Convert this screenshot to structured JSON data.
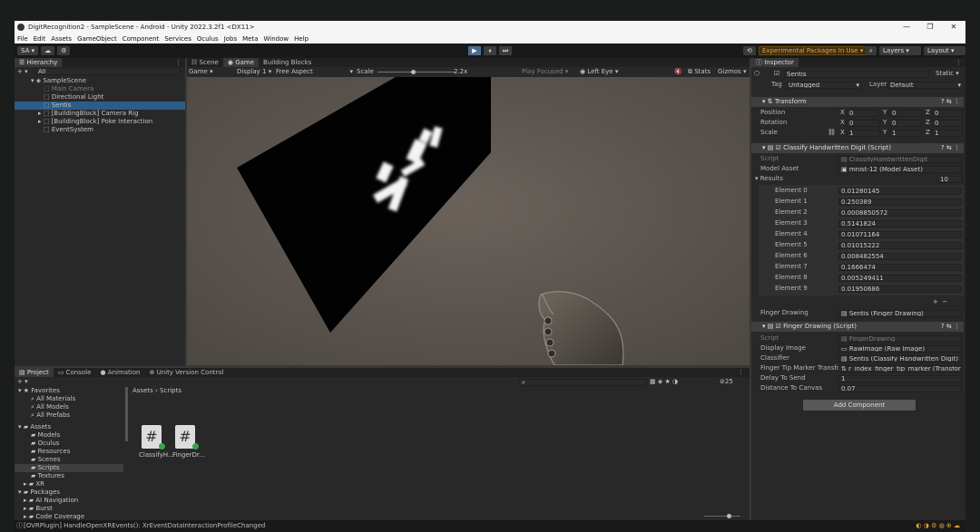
{
  "window": {
    "title": "DigitRecognition2 - SampleScene - Android - Unity 2022.3.2f1 <DX11>",
    "min": "—",
    "max": "❐",
    "close": "✕"
  },
  "menu": [
    "File",
    "Edit",
    "Assets",
    "GameObject",
    "Component",
    "Services",
    "Oculus",
    "Jobs",
    "Meta",
    "Window",
    "Help"
  ],
  "toolbar": {
    "account": "SA ▾",
    "play": "▶",
    "pause": "⏸",
    "step": "⏭",
    "experimental": "Experimental Packages In Use ▾",
    "layers": "Layers",
    "layout": "Layout"
  },
  "hierarchy": {
    "tab": "Hierarchy",
    "search": "All",
    "scene": "SampleScene",
    "items": [
      "Main Camera",
      "Directional Light",
      "Sentis",
      "[BuildingBlock] Camera Rig",
      "[BuildingBlock] Poke Interaction",
      "EventSystem"
    ]
  },
  "sceneTabs": [
    "Scene",
    "Game",
    "Building Blocks"
  ],
  "gameBar": {
    "mode": "Game",
    "display": "Display 1",
    "aspect": "Free Aspect",
    "scale_label": "Scale",
    "scale_value": "2.2x",
    "play_focused": "Play Focused",
    "eye": "Left Eye",
    "stats": "Stats",
    "gizmos": "Gizmos"
  },
  "inspector": {
    "tab": "Inspector",
    "object": "Sentis",
    "static": "Static",
    "tag_label": "Tag",
    "tag": "Untagged",
    "layer_label": "Layer",
    "layer": "Default",
    "transform": {
      "title": "Transform",
      "rows": [
        {
          "label": "Position",
          "x": "0",
          "y": "0",
          "z": "0"
        },
        {
          "label": "Rotation",
          "x": "0",
          "y": "0",
          "z": "0"
        },
        {
          "label": "Scale",
          "x": "1",
          "y": "1",
          "z": "1"
        }
      ]
    },
    "classify": {
      "title": "Classify Handwritten Digit (Script)",
      "script_label": "Script",
      "script": "ClassifyHandwrittenDigit",
      "model_label": "Model Asset",
      "model": "mnist-12 (Model Asset)",
      "results_label": "Results",
      "results_count": "10",
      "elements": [
        {
          "label": "Element 0",
          "value": "0.01280145"
        },
        {
          "label": "Element 1",
          "value": "0.250389"
        },
        {
          "label": "Element 2",
          "value": "0.0008850572"
        },
        {
          "label": "Element 3",
          "value": "0.5141824"
        },
        {
          "label": "Element 4",
          "value": "0.01071164"
        },
        {
          "label": "Element 5",
          "value": "0.01015222"
        },
        {
          "label": "Element 6",
          "value": "0.008482554"
        },
        {
          "label": "Element 7",
          "value": "0.1666474"
        },
        {
          "label": "Element 8",
          "value": "0.005249411"
        },
        {
          "label": "Element 9",
          "value": "0.01950686"
        }
      ],
      "finger_label": "Finger Drawing",
      "finger": "Sentis (Finger Drawing)"
    },
    "drawing": {
      "title": "Finger Drawing (Script)",
      "rows": [
        {
          "label": "Script",
          "value": "FingerDrawing"
        },
        {
          "label": "Display Image",
          "value": "RawImage (Raw Image)"
        },
        {
          "label": "Classifier",
          "value": "Sentis (Classify Handwritten Digit)"
        },
        {
          "label": "Finger Tip Marker Transfor",
          "value": "r_index_finger_tip_marker (Transform)"
        },
        {
          "label": "Delay To Send",
          "value": "1"
        },
        {
          "label": "Distance To Canvas",
          "value": "0.07"
        }
      ]
    },
    "add_component": "Add Component"
  },
  "project": {
    "tabs": [
      "Project",
      "Console",
      "Animation",
      "Unity Version Control"
    ],
    "count": "25",
    "favorites": {
      "label": "Favorites",
      "items": [
        "All Materials",
        "All Models",
        "All Prefabs"
      ]
    },
    "assets": {
      "label": "Assets",
      "items": [
        "Models",
        "Oculus",
        "Resources",
        "Scenes",
        "Scripts",
        "Textures",
        "XR"
      ]
    },
    "packages": {
      "label": "Packages",
      "items": [
        "AI Navigation",
        "Burst",
        "Code Coverage"
      ]
    },
    "breadcrumb": [
      "Assets",
      "Scripts"
    ],
    "files": [
      "ClassifyH...",
      "FingerDr..."
    ]
  },
  "status": "[OVRPlugin] HandleOpenXREvents(): XrEventDataInteractionProfileChanged"
}
